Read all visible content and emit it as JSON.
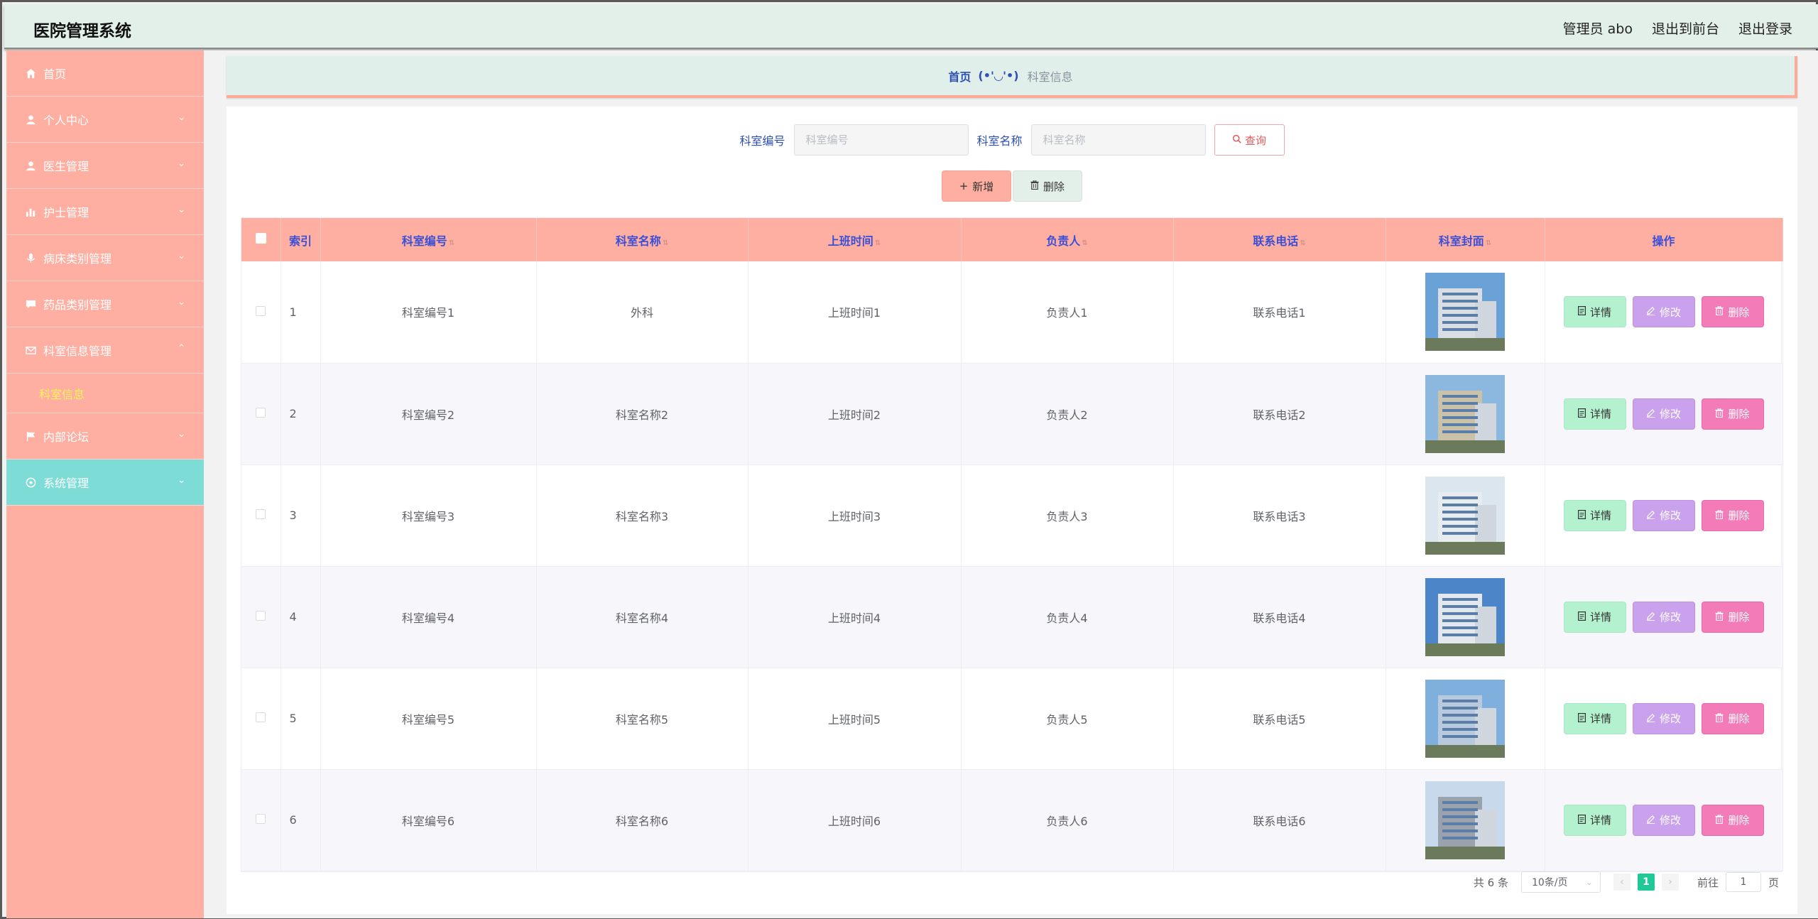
{
  "header": {
    "app_title": "医院管理系统",
    "user_label": "管理员 abo",
    "to_front": "退出到前台",
    "logout": "退出登录"
  },
  "sidebar": {
    "items": [
      {
        "label": "首页",
        "icon": "home-icon",
        "expandable": false
      },
      {
        "label": "个人中心",
        "icon": "user-icon",
        "expandable": true
      },
      {
        "label": "医生管理",
        "icon": "user-icon",
        "expandable": true
      },
      {
        "label": "护士管理",
        "icon": "bar-chart-icon",
        "expandable": true
      },
      {
        "label": "病床类别管理",
        "icon": "microphone-icon",
        "expandable": true
      },
      {
        "label": "药品类别管理",
        "icon": "chat-icon",
        "expandable": true
      },
      {
        "label": "科室信息管理",
        "icon": "mail-icon",
        "expandable": true,
        "expanded": true
      },
      {
        "label": "内部论坛",
        "icon": "flag-icon",
        "expandable": true
      },
      {
        "label": "系统管理",
        "icon": "settings-icon",
        "expandable": true,
        "active": true
      }
    ],
    "submenu": {
      "label": "科室信息"
    },
    "colors": {
      "bg": "#ffafa2",
      "active_bg": "#7edcd6",
      "submenu_text": "#fff25a"
    }
  },
  "breadcrumb": {
    "home": "首页",
    "face": "(•'◡'•)",
    "current": "科室信息"
  },
  "search": {
    "code_label": "科室编号",
    "code_placeholder": "科室编号",
    "name_label": "科室名称",
    "name_placeholder": "科室名称",
    "query_button": "查询"
  },
  "actions": {
    "add_button": "新增",
    "delete_button": "删除"
  },
  "table": {
    "columns": [
      "索引",
      "科室编号",
      "科室名称",
      "上班时间",
      "负责人",
      "联系电话",
      "科室封面",
      "操作"
    ],
    "rows": [
      {
        "index": "1",
        "code": "科室编号1",
        "name": "外科",
        "time": "上班时间1",
        "owner": "负责人1",
        "phone": "联系电话1"
      },
      {
        "index": "2",
        "code": "科室编号2",
        "name": "科室名称2",
        "time": "上班时间2",
        "owner": "负责人2",
        "phone": "联系电话2"
      },
      {
        "index": "3",
        "code": "科室编号3",
        "name": "科室名称3",
        "time": "上班时间3",
        "owner": "负责人3",
        "phone": "联系电话3"
      },
      {
        "index": "4",
        "code": "科室编号4",
        "name": "科室名称4",
        "time": "上班时间4",
        "owner": "负责人4",
        "phone": "联系电话4"
      },
      {
        "index": "5",
        "code": "科室编号5",
        "name": "科室名称5",
        "time": "上班时间5",
        "owner": "负责人5",
        "phone": "联系电话5"
      },
      {
        "index": "6",
        "code": "科室编号6",
        "name": "科室名称6",
        "time": "上班时间6",
        "owner": "负责人6",
        "phone": "联系电话6"
      }
    ],
    "row_actions": {
      "detail": "详情",
      "edit": "修改",
      "delete": "删除"
    },
    "colors": {
      "header_bg": "#ffafa2",
      "header_text": "#3a4fd6"
    }
  },
  "pagination": {
    "total": "共 6 条",
    "page_size": "10条/页",
    "current_page": "1",
    "goto_prefix": "前往",
    "goto_value": "1",
    "goto_suffix": "页"
  }
}
